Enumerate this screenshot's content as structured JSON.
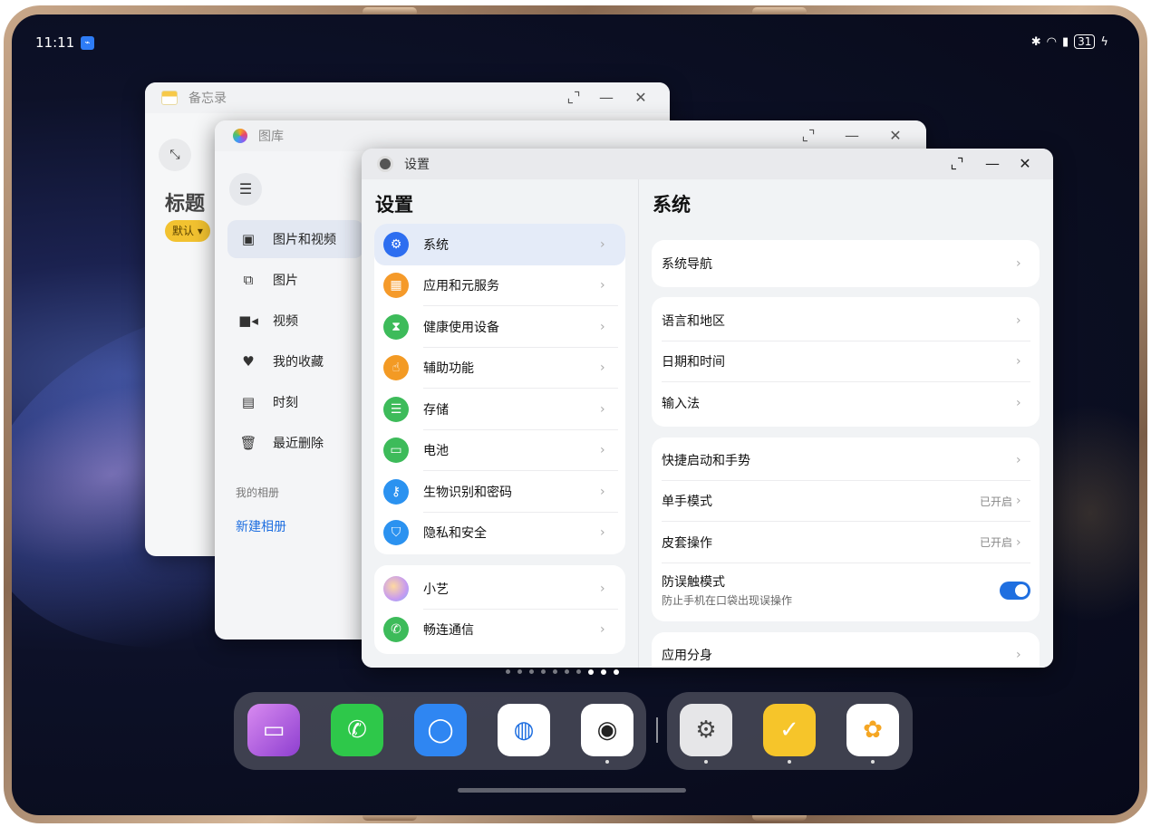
{
  "status": {
    "time": "11:11",
    "battery": "31"
  },
  "memo": {
    "title": "备忘录",
    "heading": "标题",
    "tag": "默认 ▾"
  },
  "gallery": {
    "title": "图库",
    "items": [
      {
        "label": "图片和视频",
        "icon": "photo-icon"
      },
      {
        "label": "图片",
        "icon": "images-icon"
      },
      {
        "label": "视频",
        "icon": "video-icon"
      },
      {
        "label": "我的收藏",
        "icon": "heart-icon"
      },
      {
        "label": "时刻",
        "icon": "moment-icon"
      },
      {
        "label": "最近删除",
        "icon": "trash-icon"
      }
    ],
    "my_albums": "我的相册",
    "new_album": "新建相册"
  },
  "settings": {
    "window_title": "设置",
    "left_title": "设置",
    "right_title": "系统",
    "menu_group1": [
      {
        "label": "系统",
        "color": "#2d6ef0"
      },
      {
        "label": "应用和元服务",
        "color": "#f59a2a"
      },
      {
        "label": "健康使用设备",
        "color": "#3dbb5a"
      },
      {
        "label": "辅助功能",
        "color": "#f39a24"
      },
      {
        "label": "存储",
        "color": "#3dbb5a"
      },
      {
        "label": "电池",
        "color": "#3dbb5a"
      },
      {
        "label": "生物识别和密码",
        "color": "#2b92f0"
      },
      {
        "label": "隐私和安全",
        "color": "#2b92f0"
      }
    ],
    "menu_group2": [
      {
        "label": "小艺",
        "color": "#c79bf0"
      },
      {
        "label": "畅连通信",
        "color": "#3dbb5a"
      }
    ],
    "system_nav": "系统导航",
    "group_lang": [
      "语言和地区",
      "日期和时间",
      "输入法"
    ],
    "quick_gestures": "快捷启动和手势",
    "one_hand": {
      "label": "单手模式",
      "value": "已开启"
    },
    "cover_op": {
      "label": "皮套操作",
      "value": "已开启"
    },
    "anti_touch": {
      "label": "防误触模式",
      "sub": "防止手机在口袋出现误操作",
      "enabled": true
    },
    "app_clone": "应用分身"
  },
  "dock": {
    "left_apps": [
      {
        "name": "multitask",
        "color": "#b35ee0"
      },
      {
        "name": "phone",
        "color": "#2ec84a"
      },
      {
        "name": "messages",
        "color": "#2f86f2"
      },
      {
        "name": "browser",
        "color": "#ffffff"
      },
      {
        "name": "camera",
        "color": "#ffffff"
      }
    ],
    "right_apps": [
      {
        "name": "settings",
        "color": "#e6e6e8"
      },
      {
        "name": "notes",
        "color": "#f6c52a"
      },
      {
        "name": "gallery",
        "color": "#ffffff"
      }
    ]
  }
}
